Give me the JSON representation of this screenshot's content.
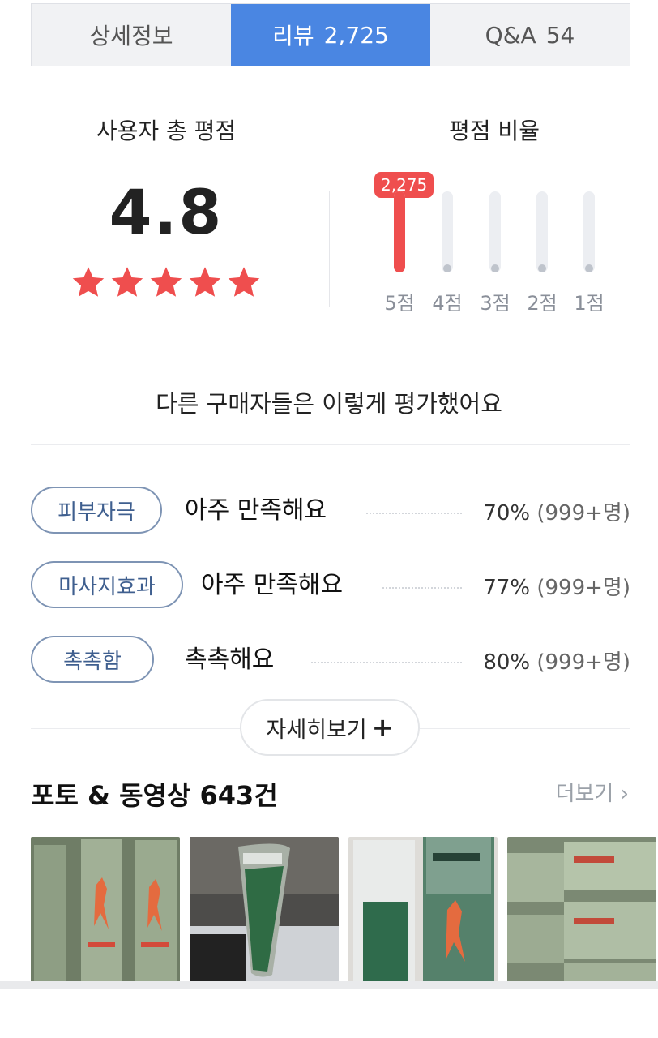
{
  "tabs": [
    {
      "label": "상세정보",
      "count": ""
    },
    {
      "label": "리뷰",
      "count": "2,725"
    },
    {
      "label": "Q&A",
      "count": "54"
    }
  ],
  "rating": {
    "title": "사용자 총 평점",
    "value": "4.8",
    "stars": 5
  },
  "ratio": {
    "title": "평점 비율",
    "top_badge": "2,275",
    "bars": [
      {
        "label": "5점",
        "fraction": 1.0
      },
      {
        "label": "4점",
        "fraction": 0
      },
      {
        "label": "3점",
        "fraction": 0
      },
      {
        "label": "2점",
        "fraction": 0
      },
      {
        "label": "1점",
        "fraction": 0
      }
    ]
  },
  "others_heading": "다른 구매자들은 이렇게 평가했어요",
  "attributes": [
    {
      "tag": "피부자극",
      "text": "아주 만족해요",
      "percent": "70%",
      "count": "(999+명)"
    },
    {
      "tag": "마사지효과",
      "text": "아주 만족해요",
      "percent": "77%",
      "count": "(999+명)"
    },
    {
      "tag": "촉촉함",
      "text": "촉촉해요",
      "percent": "80%",
      "count": "(999+명)"
    }
  ],
  "more_button": {
    "label": "자세히보기",
    "icon": "+"
  },
  "photos": {
    "title": "포토 & 동영상 643건",
    "more": "더보기",
    "chevron": "›",
    "thumbs": [
      "photo-1",
      "photo-2",
      "photo-3",
      "photo-4"
    ]
  },
  "colors": {
    "accent": "#4a86e2",
    "star": "#ef4e4e",
    "pill_border": "#7e94b4"
  }
}
